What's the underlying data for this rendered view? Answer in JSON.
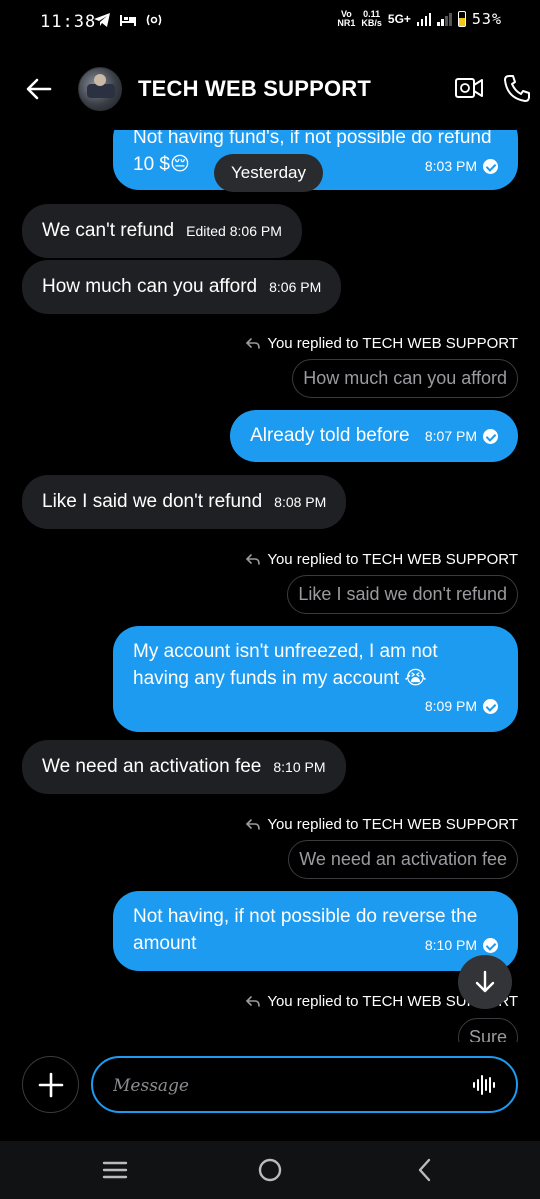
{
  "status_bar": {
    "time": "11:38",
    "net_top": "Vo",
    "net_bottom": "NR1",
    "speed_top": "0.11",
    "speed_bottom": "KB/s",
    "network_type": "5G+",
    "battery": "53%"
  },
  "header": {
    "title": "TECH WEB SUPPORT",
    "icons": [
      "back-arrow-icon",
      "avatar",
      "video-call-icon",
      "phone-call-icon"
    ]
  },
  "chat": {
    "date_separator": "Yesterday",
    "messages": [
      {
        "dir": "out",
        "text": "Not having fund's, if not possible do refund 10 $😔",
        "time": "8:03 PM"
      },
      {
        "dir": "in",
        "text": "We can't refund",
        "time": "Edited 8:06 PM"
      },
      {
        "dir": "in",
        "text": "How much can you afford",
        "time": "8:06 PM"
      },
      {
        "dir": "reply",
        "note": "You replied to TECH WEB SUPPORT",
        "quote": "How much can you afford"
      },
      {
        "dir": "out",
        "text": "Already told before",
        "time": "8:07 PM"
      },
      {
        "dir": "in",
        "text": "Like I said we don't refund",
        "time": "8:08 PM"
      },
      {
        "dir": "reply",
        "note": "You replied to TECH WEB SUPPORT",
        "quote": "Like I said we don't refund"
      },
      {
        "dir": "out",
        "text": "My account isn't unfreezed, I am not having any funds in my account 😭",
        "time": "8:09 PM"
      },
      {
        "dir": "in",
        "text": "We need an activation fee",
        "time": "8:10 PM"
      },
      {
        "dir": "reply",
        "note": "You replied to TECH WEB SUPPORT",
        "quote": "We need an activation fee"
      },
      {
        "dir": "out",
        "text": "Not having, if not possible do reverse the amount",
        "time": "8:10 PM"
      },
      {
        "dir": "reply",
        "note": "You replied to TECH WEB SUPPORT",
        "quote": "Sure"
      }
    ]
  },
  "compose": {
    "placeholder": "Message"
  },
  "colors": {
    "accent": "#1d9bf0",
    "incoming_bubble": "#1f2023",
    "background": "#000000"
  }
}
